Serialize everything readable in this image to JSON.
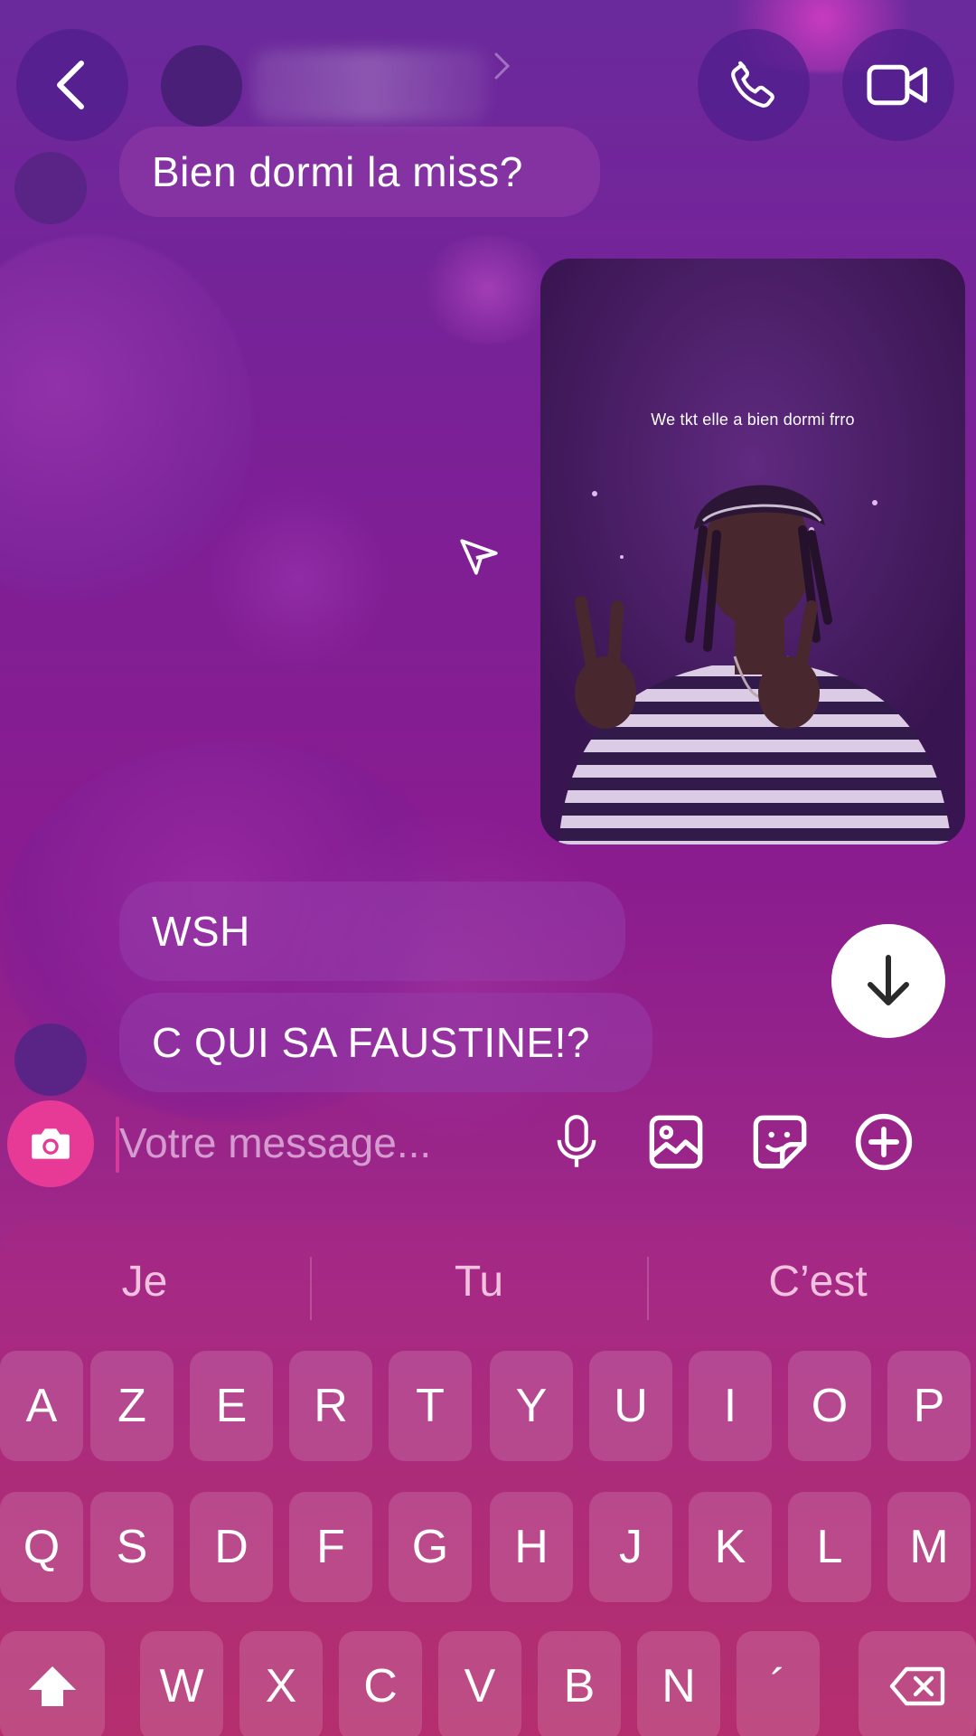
{
  "header": {
    "back_icon": "back-chevron-icon",
    "call_icon": "phone-icon",
    "video_icon": "video-camera-icon"
  },
  "messages": {
    "incoming_1": "Bien dormi la miss?",
    "reply_image_caption": "We tkt elle a bien dormi frro",
    "incoming_2": "WSH",
    "incoming_3": "C QUI SA FAUSTINE!?"
  },
  "composer": {
    "placeholder": "Votre message...",
    "icons": [
      "camera-icon",
      "microphone-icon",
      "gallery-icon",
      "sticker-icon",
      "plus-icon"
    ],
    "accent_color": "#e63a96"
  },
  "keyboard": {
    "suggestions": [
      "Je",
      "Tu",
      "C’est"
    ],
    "row1": [
      "A",
      "Z",
      "E",
      "R",
      "T",
      "Y",
      "U",
      "I",
      "O",
      "P"
    ],
    "row2": [
      "Q",
      "S",
      "D",
      "F",
      "G",
      "H",
      "J",
      "K",
      "L",
      "M"
    ],
    "row3": [
      "W",
      "X",
      "C",
      "V",
      "B",
      "N",
      "´"
    ]
  }
}
